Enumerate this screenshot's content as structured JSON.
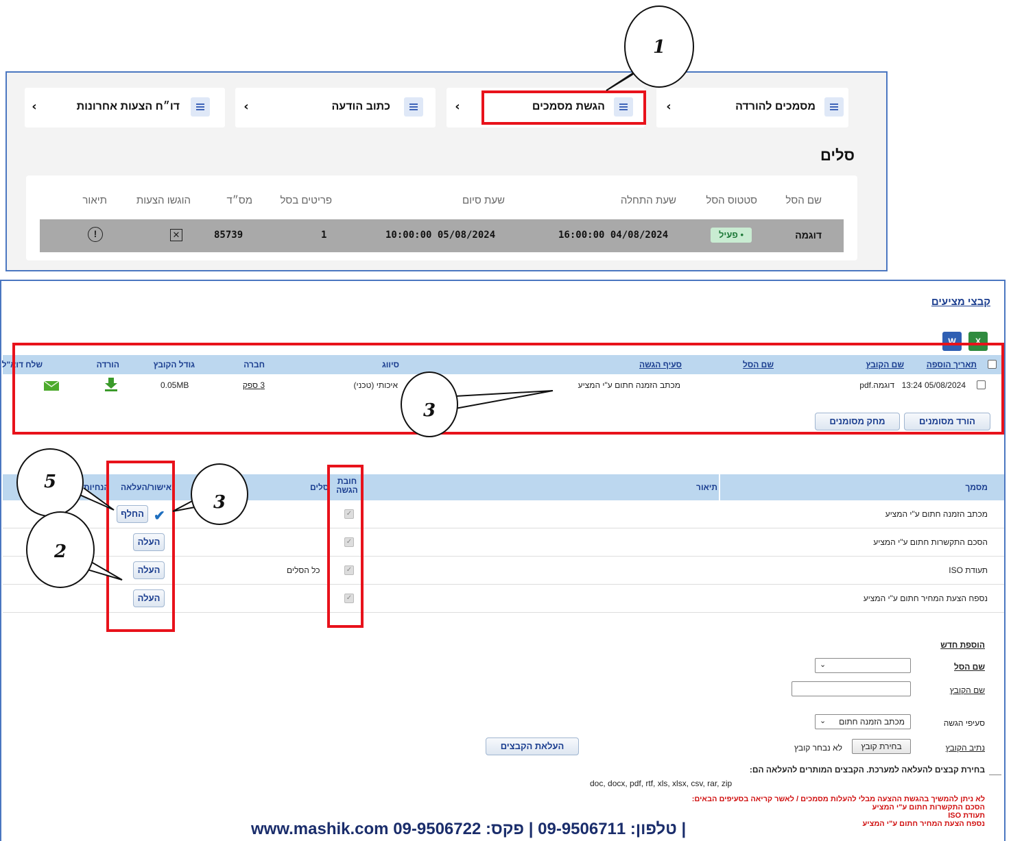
{
  "nav": {
    "items": [
      {
        "label": "מסמכים להורדה",
        "chevron": "‹"
      },
      {
        "label": "הגשת מסמכים",
        "chevron": "‹"
      },
      {
        "label": "כתוב הודעה",
        "chevron": "‹"
      },
      {
        "label": "דו״ח הצעות אחרונות",
        "chevron": "‹"
      }
    ]
  },
  "baskets": {
    "title": "סלים",
    "headers": [
      "שם הסל",
      "סטטוס הסל",
      "שעת התחלה",
      "שעת סיום",
      "פריטים בסל",
      "מס״ד",
      "הוגשו הצעות",
      "תיאור"
    ],
    "row": {
      "name": "דוגמה",
      "status": "• פעיל",
      "start": "16:00:00 04/08/2024",
      "end": "10:00:00 05/08/2024",
      "items": "1",
      "serial": "85739",
      "offers_icon": "x-box-icon",
      "info_icon": "exclamation-circle-icon"
    }
  },
  "files": {
    "title": "קבצי מציעים",
    "icons": [
      "excel-icon",
      "word-icon"
    ],
    "headers": {
      "date_added": "תאריך הוספה",
      "file_name": "שם הקובץ",
      "basket_name": "שם הסל",
      "section": "סעיף הגשה",
      "classification": "סיווג",
      "company": "חברה",
      "file_size": "גודל הקובץ",
      "download": "הורדה",
      "send_email": "שלח דוא\"ל"
    },
    "row": {
      "date_added": "13:24 05/08/2024",
      "file_name": "דוגמה.pdf",
      "section": "מכתב הזמנה חתום ע\"י המציע",
      "classification": "איכותי (טכני)",
      "company": "3 ספק",
      "file_size": "0.05MB"
    },
    "buttons": {
      "download_selected": "הורד מסומנים",
      "delete_selected": "מחק מסומנים"
    }
  },
  "documents": {
    "headers": {
      "document": "מסמך",
      "description": "תיאור",
      "required": "חובת הגשה",
      "baskets": "סלים",
      "approve_upload": "אישור/העלאה",
      "instructions": "הנחיות"
    },
    "rows": [
      {
        "name": "מכתב הזמנה חתום ע\"י המציע",
        "baskets": "",
        "action": "החלף"
      },
      {
        "name": "הסכם התקשרות חתום ע\"י המציע",
        "baskets": "",
        "action": "העלה"
      },
      {
        "name": "תעודת ISO",
        "baskets": "כל הסלים",
        "action": "העלה"
      },
      {
        "name": "נספח הצעת המחיר חתום ע\"י המציע",
        "baskets": "",
        "action": "העלה"
      }
    ]
  },
  "add_new": {
    "title": "הוספת חדש",
    "basket_label": "שם הסל",
    "file_name_label": "שם הקובץ",
    "section_label": "סעיפי הגשה",
    "section_value": "מכתב הזמנה חתום",
    "path_label": "נתיב הקובץ",
    "choose_file": "בחירת קובץ",
    "no_file": "לא נבחר קובץ",
    "upload_button": "העלאת הקבצים",
    "allowed_label": "בחירת קבצים להעלאה למערכת. הקבצים המותרים להעלאה הם:",
    "allowed_types": "doc, docx, pdf, rtf, xls, xlsx, csv, rar, zip"
  },
  "warnings": [
    "לא ניתן להמשיך בהגשת ההצעה מבלי להעלות מסמכים / לאשר קריאה בסעיפים הבאים:",
    "הסכם התקשרות חתום ע\"י המציע",
    "תעודת ISO",
    "נספח הצעת המחיר חתום ע\"י המציע"
  ],
  "footer": {
    "contact": "www.mashik.com טלפון: 09-9506711 | פקס: 09-9506722 |"
  },
  "callouts": [
    "1",
    "3",
    "5",
    "3",
    "2"
  ],
  "colors": {
    "accent": "#1a3d8f",
    "highlight": "#e8121b",
    "panel_border": "#4a76c0",
    "status_bg": "#c9ecd2",
    "table_header": "#bcd7ef"
  }
}
